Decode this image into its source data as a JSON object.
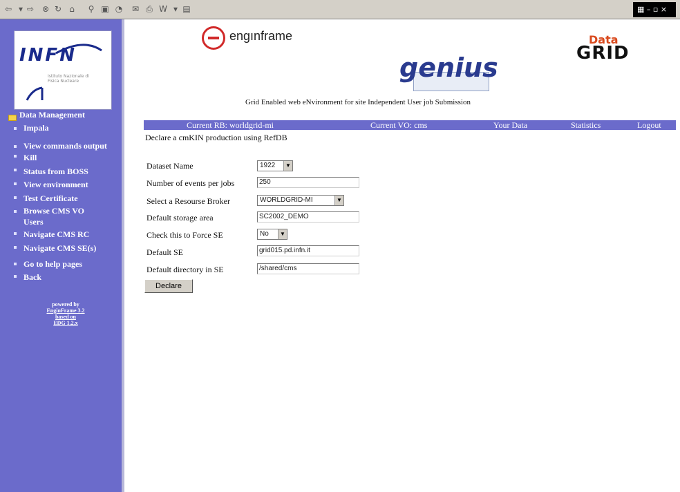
{
  "toolbar": {
    "icons": [
      "back-icon",
      "forward-icon",
      "stop-icon",
      "refresh-icon",
      "home-icon",
      "search-icon",
      "favorites-icon",
      "history-icon",
      "mail-icon",
      "print-icon",
      "edit-icon",
      "discuss-icon"
    ],
    "corner_logo": "windows-logo"
  },
  "sidebar": {
    "logo_text": "INFN",
    "logo_subtext": "Istituto Nazionale di Fisica Nucleare",
    "items": [
      {
        "label": "Data Management"
      },
      {
        "label": "Impala"
      },
      {
        "label": "View commands output"
      },
      {
        "label": "Kill"
      },
      {
        "label": "Status from BOSS"
      },
      {
        "label": "View environment"
      },
      {
        "label": "Test Certificate"
      },
      {
        "label": "Browse CMS VO"
      },
      {
        "label": "Users"
      },
      {
        "label": "Navigate CMS RC"
      },
      {
        "label": "Navigate CMS SE(s)"
      },
      {
        "label": "Go to help pages"
      },
      {
        "label": "Back"
      }
    ],
    "powered": {
      "line1": "powered by",
      "line2": "EnginFrame 3.2",
      "line3": "based on",
      "line4": "EDG 1.2.x"
    }
  },
  "header": {
    "enginframe": "engınframe",
    "genius": "genius",
    "datagrid_top": "Data",
    "datagrid_bottom": "GRID",
    "tagline": "Grid Enabled web eNvironment for site Independent User job Submission"
  },
  "navbar": {
    "current_rb": "Current RB: worldgrid-mi",
    "current_vo": "Current VO: cms",
    "your_data": "Your Data",
    "statistics": "Statistics",
    "logout": "Logout"
  },
  "page": {
    "title": "Declare a cmKIN production using RefDB"
  },
  "form": {
    "dataset_label": "Dataset Name",
    "dataset_value": "1922",
    "events_label": "Number of events per jobs",
    "events_value": "250",
    "broker_label": "Select a Resourse Broker",
    "broker_value": "WORLDGRID-MI",
    "storage_label": "Default storage area",
    "storage_value": "SC2002_DEMO",
    "force_label": "Check this to Force SE",
    "force_value": "No",
    "se_label": "Default SE",
    "se_value": "grid015.pd.infn.it",
    "dir_label": "Default directory in SE",
    "dir_value": "/shared/cms",
    "declare_button": "Declare"
  }
}
